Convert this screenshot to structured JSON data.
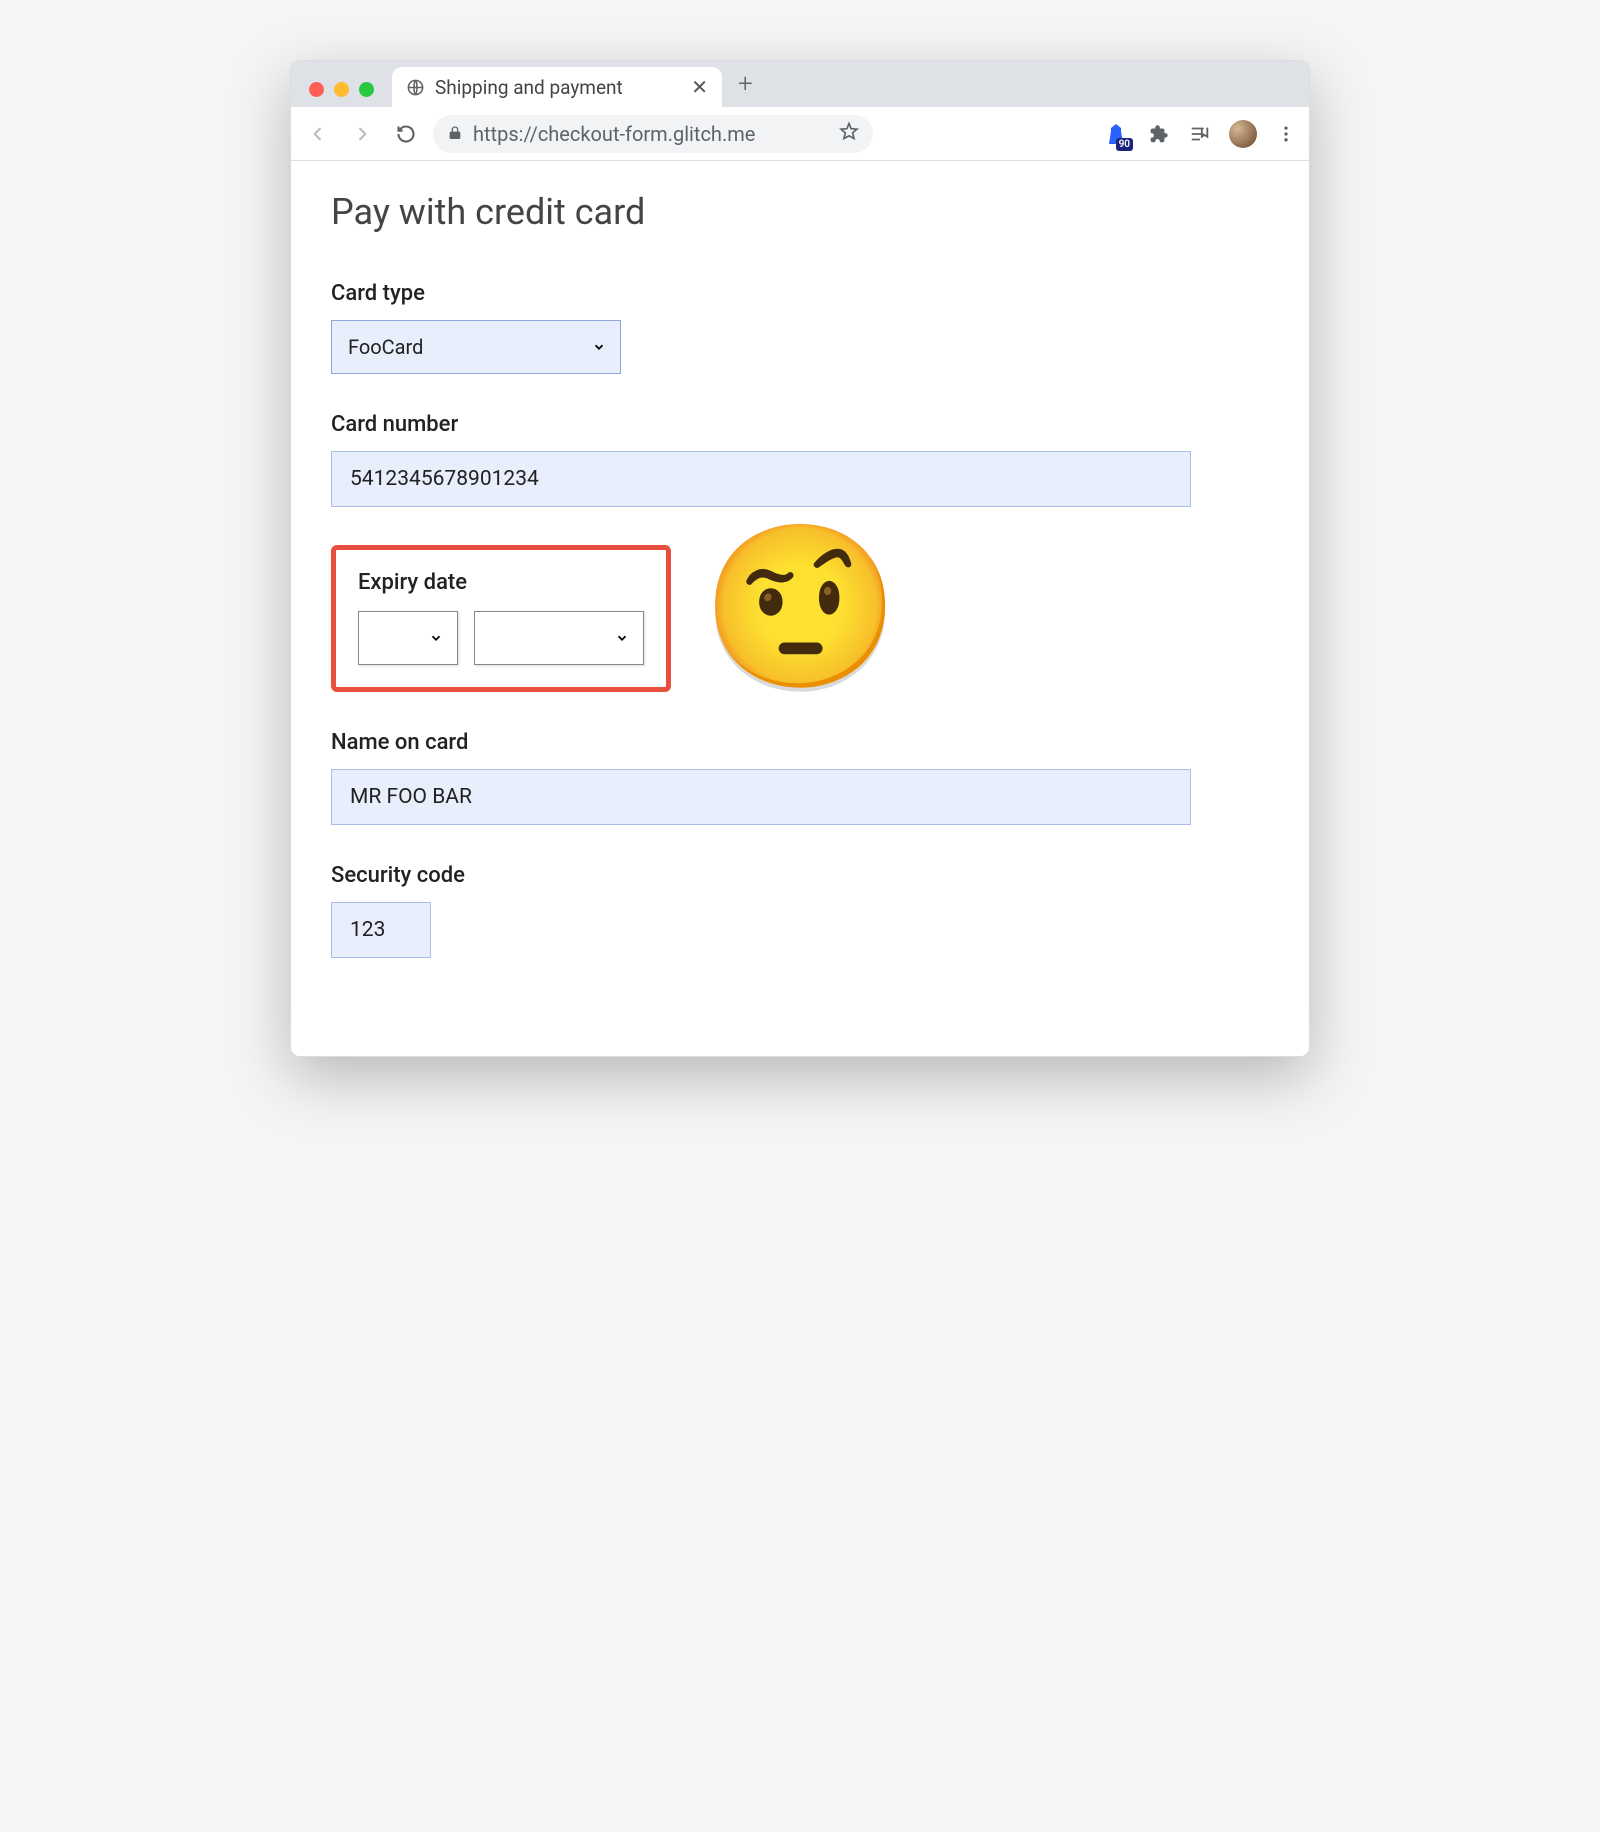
{
  "browser": {
    "tab_title": "Shipping and payment",
    "url_display": "https://checkout-form.glitch.me",
    "new_tab_plus": "+",
    "close_x": "✕",
    "lighthouse_badge": "90"
  },
  "page": {
    "title": "Pay with credit card"
  },
  "form": {
    "card_type": {
      "label": "Card type",
      "value": "FooCard"
    },
    "card_number": {
      "label": "Card number",
      "value": "5412345678901234"
    },
    "expiry": {
      "label": "Expiry date",
      "month_value": "",
      "year_value": ""
    },
    "name": {
      "label": "Name on card",
      "value": "MR FOO BAR"
    },
    "security": {
      "label": "Security code",
      "value": "123"
    }
  },
  "annotation": {
    "emoji": "🤨"
  }
}
